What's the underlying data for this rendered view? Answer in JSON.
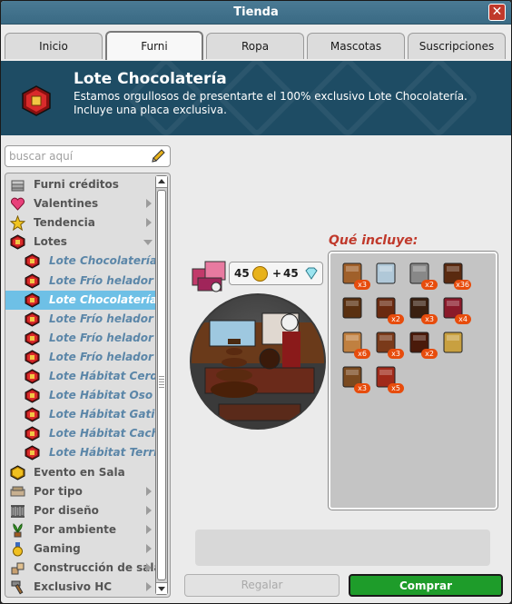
{
  "window": {
    "title": "Tienda"
  },
  "tabs": [
    {
      "label": "Inicio"
    },
    {
      "label": "Furni"
    },
    {
      "label": "Ropa"
    },
    {
      "label": "Mascotas"
    },
    {
      "label": "Suscripciones"
    }
  ],
  "active_tab": "Furni",
  "banner": {
    "title": "Lote Chocolatería",
    "description": "Estamos orgullosos de presentarte el 100% exclusivo Lote Chocolatería. Incluye una placa exclusiva."
  },
  "search": {
    "placeholder": "buscar aquí"
  },
  "tree": [
    {
      "label": "Furni créditos",
      "type": "cat",
      "icon": "stack-icon"
    },
    {
      "label": "Valentines",
      "type": "cat",
      "icon": "heart-icon",
      "arrow": "right"
    },
    {
      "label": "Tendencia",
      "type": "cat",
      "icon": "star-icon",
      "arrow": "right"
    },
    {
      "label": "Lotes",
      "type": "cat",
      "icon": "red-gem-icon",
      "arrow": "down"
    },
    {
      "label": "Lote Chocolatería",
      "type": "sub",
      "icon": "red-gem-icon"
    },
    {
      "label": "Lote Frío helador I",
      "type": "sub",
      "icon": "red-gem-icon"
    },
    {
      "label": "Lote Chocolatería",
      "type": "sub",
      "icon": "red-gem-icon",
      "selected": true
    },
    {
      "label": "Lote Frío helador I",
      "type": "sub",
      "icon": "red-gem-icon"
    },
    {
      "label": "Lote Frío helador II",
      "type": "sub",
      "icon": "red-gem-icon"
    },
    {
      "label": "Lote Frío helador II",
      "type": "sub",
      "icon": "red-gem-icon"
    },
    {
      "label": "Lote Hábitat Cerdito",
      "type": "sub",
      "icon": "red-gem-icon"
    },
    {
      "label": "Lote Hábitat Oso Polar",
      "type": "sub",
      "icon": "red-gem-icon"
    },
    {
      "label": "Lote Hábitat Gatito",
      "type": "sub",
      "icon": "red-gem-icon"
    },
    {
      "label": "Lote Hábitat Cachorro",
      "type": "sub",
      "icon": "red-gem-icon"
    },
    {
      "label": "Lote Hábitat Terrier",
      "type": "sub",
      "icon": "red-gem-icon"
    },
    {
      "label": "Evento en Sala",
      "type": "cat",
      "icon": "gold-gem-icon"
    },
    {
      "label": "Por tipo",
      "type": "cat",
      "icon": "sofa-icon",
      "arrow": "right"
    },
    {
      "label": "Por diseño",
      "type": "cat",
      "icon": "columns-icon",
      "arrow": "right"
    },
    {
      "label": "Por ambiente",
      "type": "cat",
      "icon": "plant-icon",
      "arrow": "right"
    },
    {
      "label": "Gaming",
      "type": "cat",
      "icon": "medal-icon",
      "arrow": "right"
    },
    {
      "label": "Construcción de salas",
      "type": "cat",
      "icon": "blocks-icon",
      "arrow": "right"
    },
    {
      "label": "Exclusivo HC",
      "type": "cat",
      "icon": "hammer-icon",
      "arrow": "right"
    }
  ],
  "price": {
    "credits": "45",
    "plus": "+",
    "diamonds": "45"
  },
  "includes": {
    "title": "Qué incluye:",
    "items": [
      {
        "icon": "cabinet-icon",
        "count": "x3"
      },
      {
        "icon": "display-case-icon",
        "count": ""
      },
      {
        "icon": "cups-icon",
        "count": "x2"
      },
      {
        "icon": "chocolate-bar-icon",
        "count": "x36"
      },
      {
        "icon": "fountain-icon",
        "count": ""
      },
      {
        "icon": "cake-icon",
        "count": "x2"
      },
      {
        "icon": "counter-icon",
        "count": "x3"
      },
      {
        "icon": "frame-icon",
        "count": "x4"
      },
      {
        "icon": "chair-icon",
        "count": "x6"
      },
      {
        "icon": "table-icon",
        "count": "x3"
      },
      {
        "icon": "shelf-icon",
        "count": "x2"
      },
      {
        "icon": "badge-icon",
        "count": ""
      },
      {
        "icon": "lamp-icon",
        "count": "x3"
      },
      {
        "icon": "box-icon",
        "count": "x5"
      }
    ]
  },
  "buttons": {
    "gift": "Regalar",
    "buy": "Comprar"
  },
  "colors": {
    "accent": "#1e9c2a",
    "banner": "#1e4c64",
    "selected": "#6ec0e6",
    "includes_title": "#c0392b"
  }
}
